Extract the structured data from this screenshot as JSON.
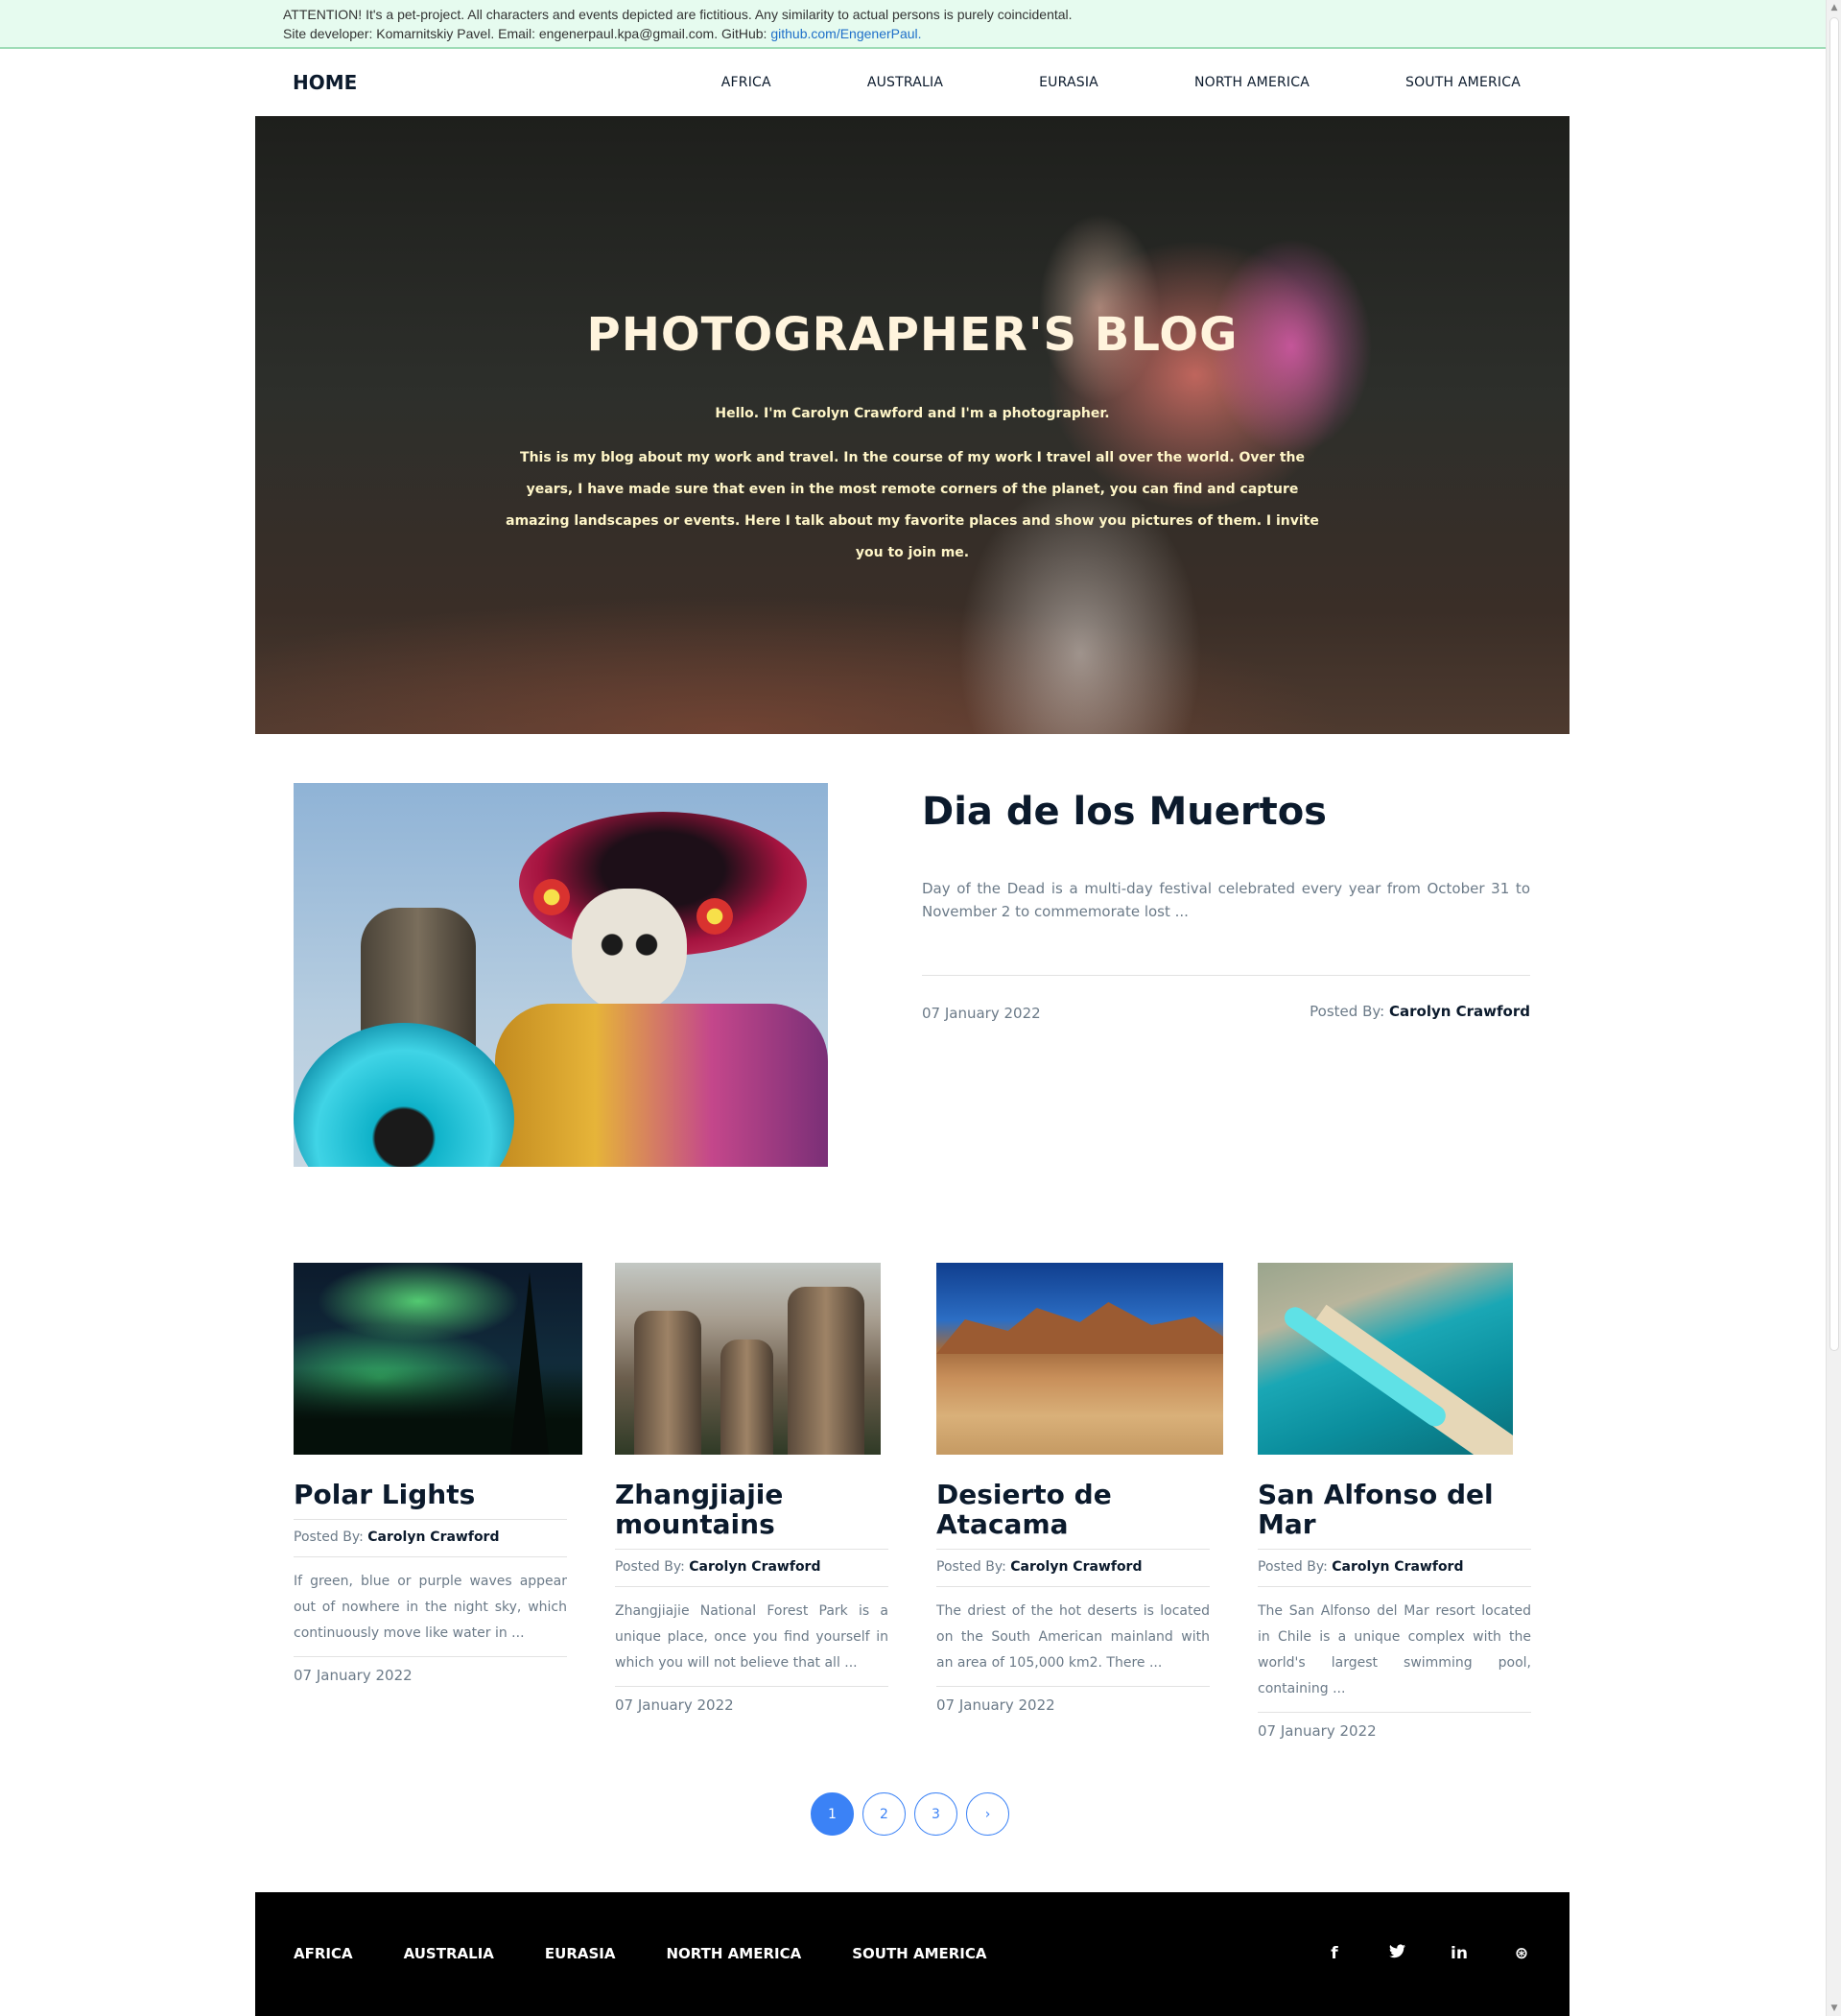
{
  "notice": {
    "line1": "ATTENTION! It's a pet-project. All characters and events depicted are fictitious. Any similarity to actual persons is purely coincidental.",
    "line2": "Site developer: Komarnitskiy Pavel. Email: engenerpaul.kpa@gmail.com. GitHub: ",
    "github_link": "github.com/EngenerPaul."
  },
  "nav": {
    "home": "HOME",
    "links": [
      "AFRICA",
      "AUSTRALIA",
      "EURASIA",
      "NORTH AMERICA",
      "SOUTH AMERICA"
    ]
  },
  "hero": {
    "title": "PHOTOGRAPHER'S BLOG",
    "greeting": "Hello. I'm Carolyn Crawford and I'm a photographer.",
    "text": "This is my blog about my work and travel. In the course of my work I travel all over the world. Over the years, I have made sure that even in the most remote corners of the planet, you can find and capture amazing landscapes or events. Here I talk about my favorite places and show you pictures of them. I invite you to join me."
  },
  "featured": {
    "title": "Dia de los Muertos",
    "excerpt": "Day of the Dead is a multi-day festival celebrated every year from October 31 to November 2 to commemorate lost ...",
    "date": "07 January 2022",
    "posted_label": "Posted By: ",
    "author": "Carolyn Crawford"
  },
  "posts": [
    {
      "title": "Polar Lights",
      "posted_label": "Posted By: ",
      "author": "Carolyn Crawford",
      "excerpt": "If green, blue or purple waves appear out of nowhere in the night sky, which continuously move like water in ...",
      "date": "07 January 2022"
    },
    {
      "title": "Zhangjiajie mountains",
      "posted_label": "Posted By: ",
      "author": "Carolyn Crawford",
      "excerpt": "Zhangjiajie National Forest Park is a unique place, once you find yourself in which you will not believe that all ...",
      "date": "07 January 2022"
    },
    {
      "title": "Desierto de Atacama",
      "posted_label": "Posted By: ",
      "author": "Carolyn Crawford",
      "excerpt": "The driest of the hot deserts is located on the South American mainland with an area of 105,000 km2. There ...",
      "date": "07 January 2022"
    },
    {
      "title": "San Alfonso del Mar",
      "posted_label": "Posted By: ",
      "author": "Carolyn Crawford",
      "excerpt": "The San Alfonso del Mar resort located in Chile is a unique complex with the world's largest swimming pool, containing ...",
      "date": "07 January 2022"
    }
  ],
  "pagination": {
    "pages": [
      "1",
      "2",
      "3"
    ],
    "current": "1",
    "next": "›"
  },
  "footer": {
    "links": [
      "AFRICA",
      "AUSTRALIA",
      "EURASIA",
      "NORTH AMERICA",
      "SOUTH AMERICA"
    ],
    "social": [
      {
        "icon": "facebook-icon",
        "glyph": "f"
      },
      {
        "icon": "twitter-icon",
        "glyph": "🐦"
      },
      {
        "icon": "linkedin-icon",
        "glyph": "in"
      },
      {
        "icon": "dribbble-icon",
        "glyph": "⊛"
      }
    ]
  },
  "colors": {
    "accent": "#3b82f6",
    "notice_bg": "#e6fbef",
    "heading": "#0b1a2c",
    "hero_text": "#fff6c8"
  }
}
